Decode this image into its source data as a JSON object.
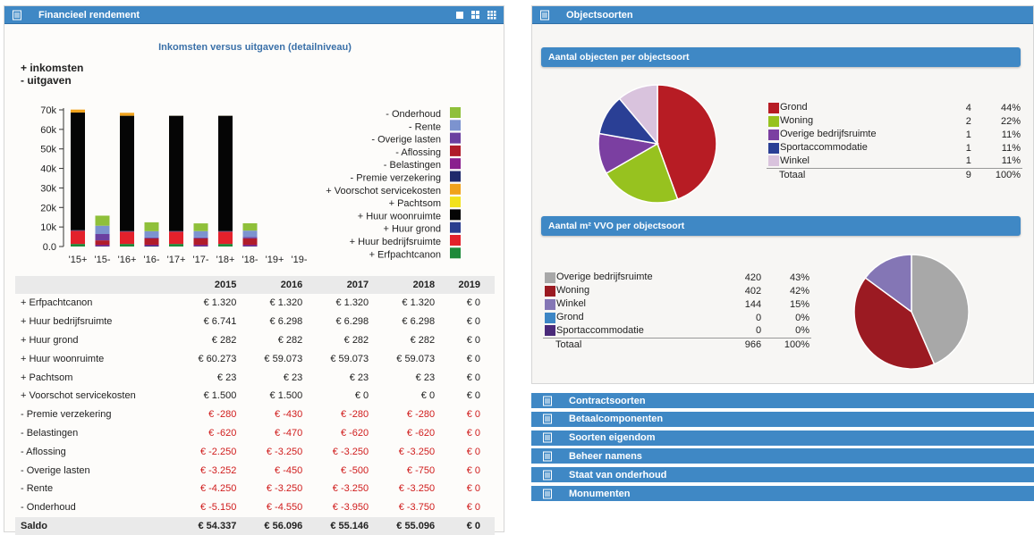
{
  "left_panel": {
    "title": "Financieel rendement",
    "tools": [
      "single-view-icon",
      "grid-4-icon",
      "grid-9-icon"
    ]
  },
  "chart_data": {
    "type": "bar",
    "title": "Inkomsten versus uitgaven (detailniveau)",
    "legend_top": [
      "+ inkomsten",
      "- uitgaven"
    ],
    "categories": [
      "'15+",
      "'15-",
      "'16+",
      "'16-",
      "'17+",
      "'17-",
      "'18+",
      "'18-",
      "'19+",
      "'19-"
    ],
    "ylim": [
      0,
      70000
    ],
    "yticks": [
      "0.0",
      "10k",
      "20k",
      "30k",
      "40k",
      "50k",
      "60k",
      "70k"
    ],
    "series": [
      {
        "name": "+ Erfpachtcanon",
        "color": "#1e8a3a",
        "values": [
          1320,
          0,
          1320,
          0,
          1320,
          0,
          1320,
          0,
          0,
          0
        ]
      },
      {
        "name": "+ Huur bedrijfsruimte",
        "color": "#e3212b",
        "values": [
          6741,
          0,
          6298,
          0,
          6298,
          0,
          6298,
          0,
          0,
          0
        ]
      },
      {
        "name": "+ Huur grond",
        "color": "#2a3d8f",
        "values": [
          282,
          0,
          282,
          0,
          282,
          0,
          282,
          0,
          0,
          0
        ]
      },
      {
        "name": "+ Huur woonruimte",
        "color": "#050505",
        "values": [
          60273,
          0,
          59073,
          0,
          59073,
          0,
          59073,
          0,
          0,
          0
        ]
      },
      {
        "name": "+ Pachtsom",
        "color": "#f2e21c",
        "values": [
          23,
          0,
          23,
          0,
          23,
          0,
          23,
          0,
          0,
          0
        ]
      },
      {
        "name": "+ Voorschot servicekosten",
        "color": "#f0a21c",
        "values": [
          1500,
          0,
          1500,
          0,
          0,
          0,
          0,
          0,
          0,
          0
        ]
      },
      {
        "name": "- Premie verzekering",
        "color": "#1f2a6b",
        "values": [
          0,
          280,
          0,
          430,
          0,
          280,
          0,
          280,
          0,
          0
        ]
      },
      {
        "name": "- Belastingen",
        "color": "#8a1f8e",
        "values": [
          0,
          620,
          0,
          470,
          0,
          620,
          0,
          620,
          0,
          0
        ]
      },
      {
        "name": "- Aflossing",
        "color": "#b01c2a",
        "values": [
          0,
          2250,
          0,
          3250,
          0,
          3250,
          0,
          3250,
          0,
          0
        ]
      },
      {
        "name": "- Overige lasten",
        "color": "#6b3fa0",
        "values": [
          0,
          3252,
          0,
          450,
          0,
          500,
          0,
          750,
          0,
          0
        ]
      },
      {
        "name": "- Rente",
        "color": "#7c93cf",
        "values": [
          0,
          4250,
          0,
          3250,
          0,
          3250,
          0,
          3250,
          0,
          0
        ]
      },
      {
        "name": "- Onderhoud",
        "color": "#8fc03a",
        "values": [
          0,
          5150,
          0,
          4550,
          0,
          3950,
          0,
          3750,
          0,
          0
        ]
      }
    ],
    "legend_order": [
      "- Onderhoud",
      "- Rente",
      "- Overige lasten",
      "- Aflossing",
      "- Belastingen",
      "- Premie verzekering",
      "+ Voorschot servicekosten",
      "+ Pachtsom",
      "+ Huur woonruimte",
      "+ Huur grond",
      "+ Huur bedrijfsruimte",
      "+ Erfpachtcanon"
    ]
  },
  "table": {
    "columns": [
      "",
      "2015",
      "2016",
      "2017",
      "2018",
      "2019"
    ],
    "rows": [
      {
        "label": "+ Erfpachtcanon",
        "neg": false,
        "values": [
          "€ 1.320",
          "€ 1.320",
          "€ 1.320",
          "€ 1.320",
          "€ 0"
        ]
      },
      {
        "label": "+ Huur bedrijfsruimte",
        "neg": false,
        "values": [
          "€ 6.741",
          "€ 6.298",
          "€ 6.298",
          "€ 6.298",
          "€ 0"
        ]
      },
      {
        "label": "+ Huur grond",
        "neg": false,
        "values": [
          "€ 282",
          "€ 282",
          "€ 282",
          "€ 282",
          "€ 0"
        ]
      },
      {
        "label": "+ Huur woonruimte",
        "neg": false,
        "values": [
          "€ 60.273",
          "€ 59.073",
          "€ 59.073",
          "€ 59.073",
          "€ 0"
        ]
      },
      {
        "label": "+ Pachtsom",
        "neg": false,
        "values": [
          "€ 23",
          "€ 23",
          "€ 23",
          "€ 23",
          "€ 0"
        ]
      },
      {
        "label": "+ Voorschot servicekosten",
        "neg": false,
        "values": [
          "€ 1.500",
          "€ 1.500",
          "€ 0",
          "€ 0",
          "€ 0"
        ]
      },
      {
        "label": "- Premie verzekering",
        "neg": true,
        "values": [
          "€ -280",
          "€ -430",
          "€ -280",
          "€ -280",
          "€ 0"
        ]
      },
      {
        "label": "- Belastingen",
        "neg": true,
        "values": [
          "€ -620",
          "€ -470",
          "€ -620",
          "€ -620",
          "€ 0"
        ]
      },
      {
        "label": "- Aflossing",
        "neg": true,
        "values": [
          "€ -2.250",
          "€ -3.250",
          "€ -3.250",
          "€ -3.250",
          "€ 0"
        ]
      },
      {
        "label": "- Overige lasten",
        "neg": true,
        "values": [
          "€ -3.252",
          "€ -450",
          "€ -500",
          "€ -750",
          "€ 0"
        ]
      },
      {
        "label": "- Rente",
        "neg": true,
        "values": [
          "€ -4.250",
          "€ -3.250",
          "€ -3.250",
          "€ -3.250",
          "€ 0"
        ]
      },
      {
        "label": "- Onderhoud",
        "neg": true,
        "values": [
          "€ -5.150",
          "€ -4.550",
          "€ -3.950",
          "€ -3.750",
          "€ 0"
        ]
      }
    ],
    "saldo": {
      "label": "Saldo",
      "values": [
        "€ 54.337",
        "€ 56.096",
        "€ 55.146",
        "€ 55.096",
        "€ 0"
      ]
    }
  },
  "right_panel": {
    "title": "Objectsoorten",
    "sub1": {
      "title": "Aantal objecten per objectsoort",
      "items": [
        {
          "name": "Grond",
          "color": "#b71c24",
          "count": "4",
          "pct": "44%",
          "value": 4
        },
        {
          "name": "Woning",
          "color": "#97c21f",
          "count": "2",
          "pct": "22%",
          "value": 2
        },
        {
          "name": "Overige bedrijfsruimte",
          "color": "#7b3fa1",
          "count": "1",
          "pct": "11%",
          "value": 1
        },
        {
          "name": "Sportaccommodatie",
          "color": "#2a3f95",
          "count": "1",
          "pct": "11%",
          "value": 1
        },
        {
          "name": "Winkel",
          "color": "#d9c3dd",
          "count": "1",
          "pct": "11%",
          "value": 1
        }
      ],
      "total": {
        "label": "Totaal",
        "count": "9",
        "pct": "100%"
      }
    },
    "sub2": {
      "title": "Aantal m² VVO per objectsoort",
      "items": [
        {
          "name": "Overige bedrijfsruimte",
          "color": "#a8a8a8",
          "count": "420",
          "pct": "43%",
          "value": 420
        },
        {
          "name": "Woning",
          "color": "#9b1a22",
          "count": "402",
          "pct": "42%",
          "value": 402
        },
        {
          "name": "Winkel",
          "color": "#8476b5",
          "count": "144",
          "pct": "15%",
          "value": 144
        },
        {
          "name": "Grond",
          "color": "#3d86c5",
          "count": "0",
          "pct": "0%",
          "value": 0
        },
        {
          "name": "Sportaccommodatie",
          "color": "#4a2a7a",
          "count": "0",
          "pct": "0%",
          "value": 0
        }
      ],
      "total": {
        "label": "Totaal",
        "count": "966",
        "pct": "100%"
      }
    }
  },
  "collapsed_panels": [
    "Contractsoorten",
    "Betaalcomponenten",
    "Soorten eigendom",
    "Beheer namens",
    "Staat van onderhoud",
    "Monumenten"
  ]
}
